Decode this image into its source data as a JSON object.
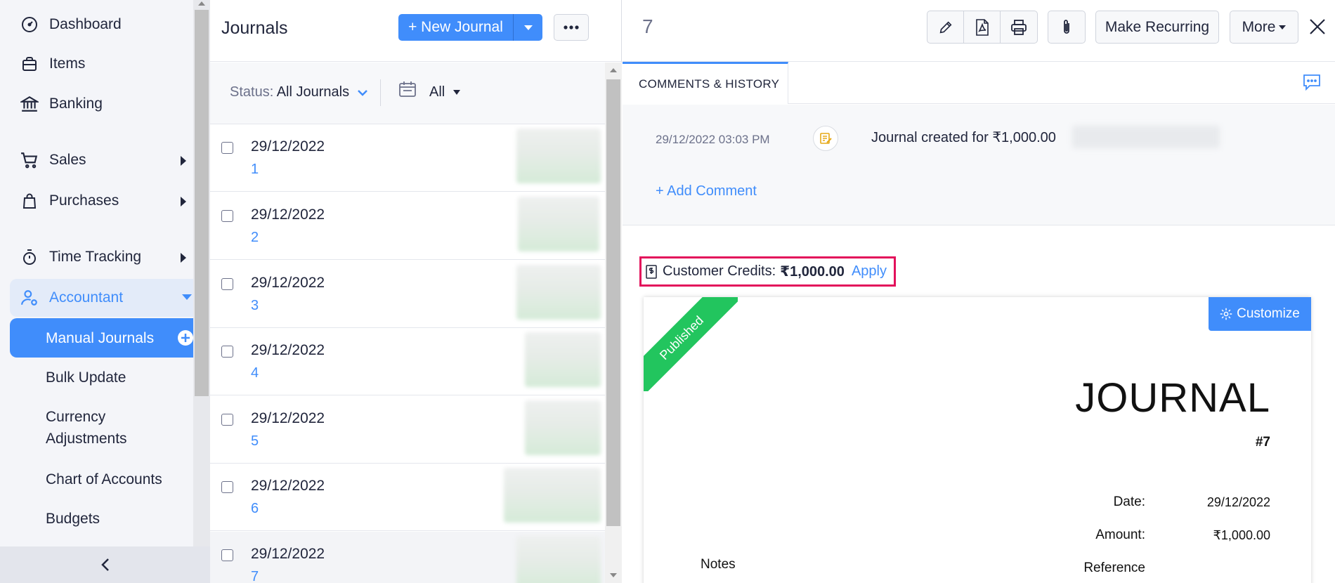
{
  "sidebar": {
    "items": [
      {
        "label": "Dashboard",
        "icon": "dashboard-icon"
      },
      {
        "label": "Items",
        "icon": "items-icon"
      },
      {
        "label": "Banking",
        "icon": "bank-icon"
      },
      {
        "label": "Sales",
        "icon": "cart-icon"
      },
      {
        "label": "Purchases",
        "icon": "bag-icon"
      },
      {
        "label": "Time Tracking",
        "icon": "stopwatch-icon"
      },
      {
        "label": "Accountant",
        "icon": "accountant-icon"
      }
    ],
    "sub_items": [
      {
        "label": "Manual Journals"
      },
      {
        "label": "Bulk Update"
      },
      {
        "label": "Currency Adjustments"
      },
      {
        "label": "Chart of Accounts"
      },
      {
        "label": "Budgets"
      }
    ]
  },
  "list": {
    "title": "Journals",
    "new_button": "+ New Journal",
    "status_label": "Status:",
    "status_value": "All Journals",
    "period_value": "All",
    "rows": [
      {
        "date": "29/12/2022",
        "number": "1"
      },
      {
        "date": "29/12/2022",
        "number": "2"
      },
      {
        "date": "29/12/2022",
        "number": "3"
      },
      {
        "date": "29/12/2022",
        "number": "4"
      },
      {
        "date": "29/12/2022",
        "number": "5"
      },
      {
        "date": "29/12/2022",
        "number": "6"
      },
      {
        "date": "29/12/2022",
        "number": "7"
      }
    ]
  },
  "detail": {
    "number": "7",
    "make_recurring": "Make Recurring",
    "more": "More",
    "tab": "COMMENTS & HISTORY",
    "history": {
      "time": "29/12/2022 03:03 PM",
      "text": "Journal created for ₹1,000.00"
    },
    "add_comment": "+ Add Comment",
    "credits": {
      "label": "Customer Credits:",
      "amount": "₹1,000.00",
      "apply": "Apply"
    },
    "document": {
      "ribbon": "Published",
      "customize": "Customize",
      "title": "JOURNAL",
      "number": "#7",
      "date_label": "Date:",
      "date_value": "29/12/2022",
      "amount_label": "Amount:",
      "amount_value": "₹1,000.00",
      "reference_label": "Reference",
      "notes_label": "Notes"
    }
  },
  "colors": {
    "accent": "#408dfb",
    "highlight_border": "#e3115b",
    "ribbon": "#22c55e"
  }
}
